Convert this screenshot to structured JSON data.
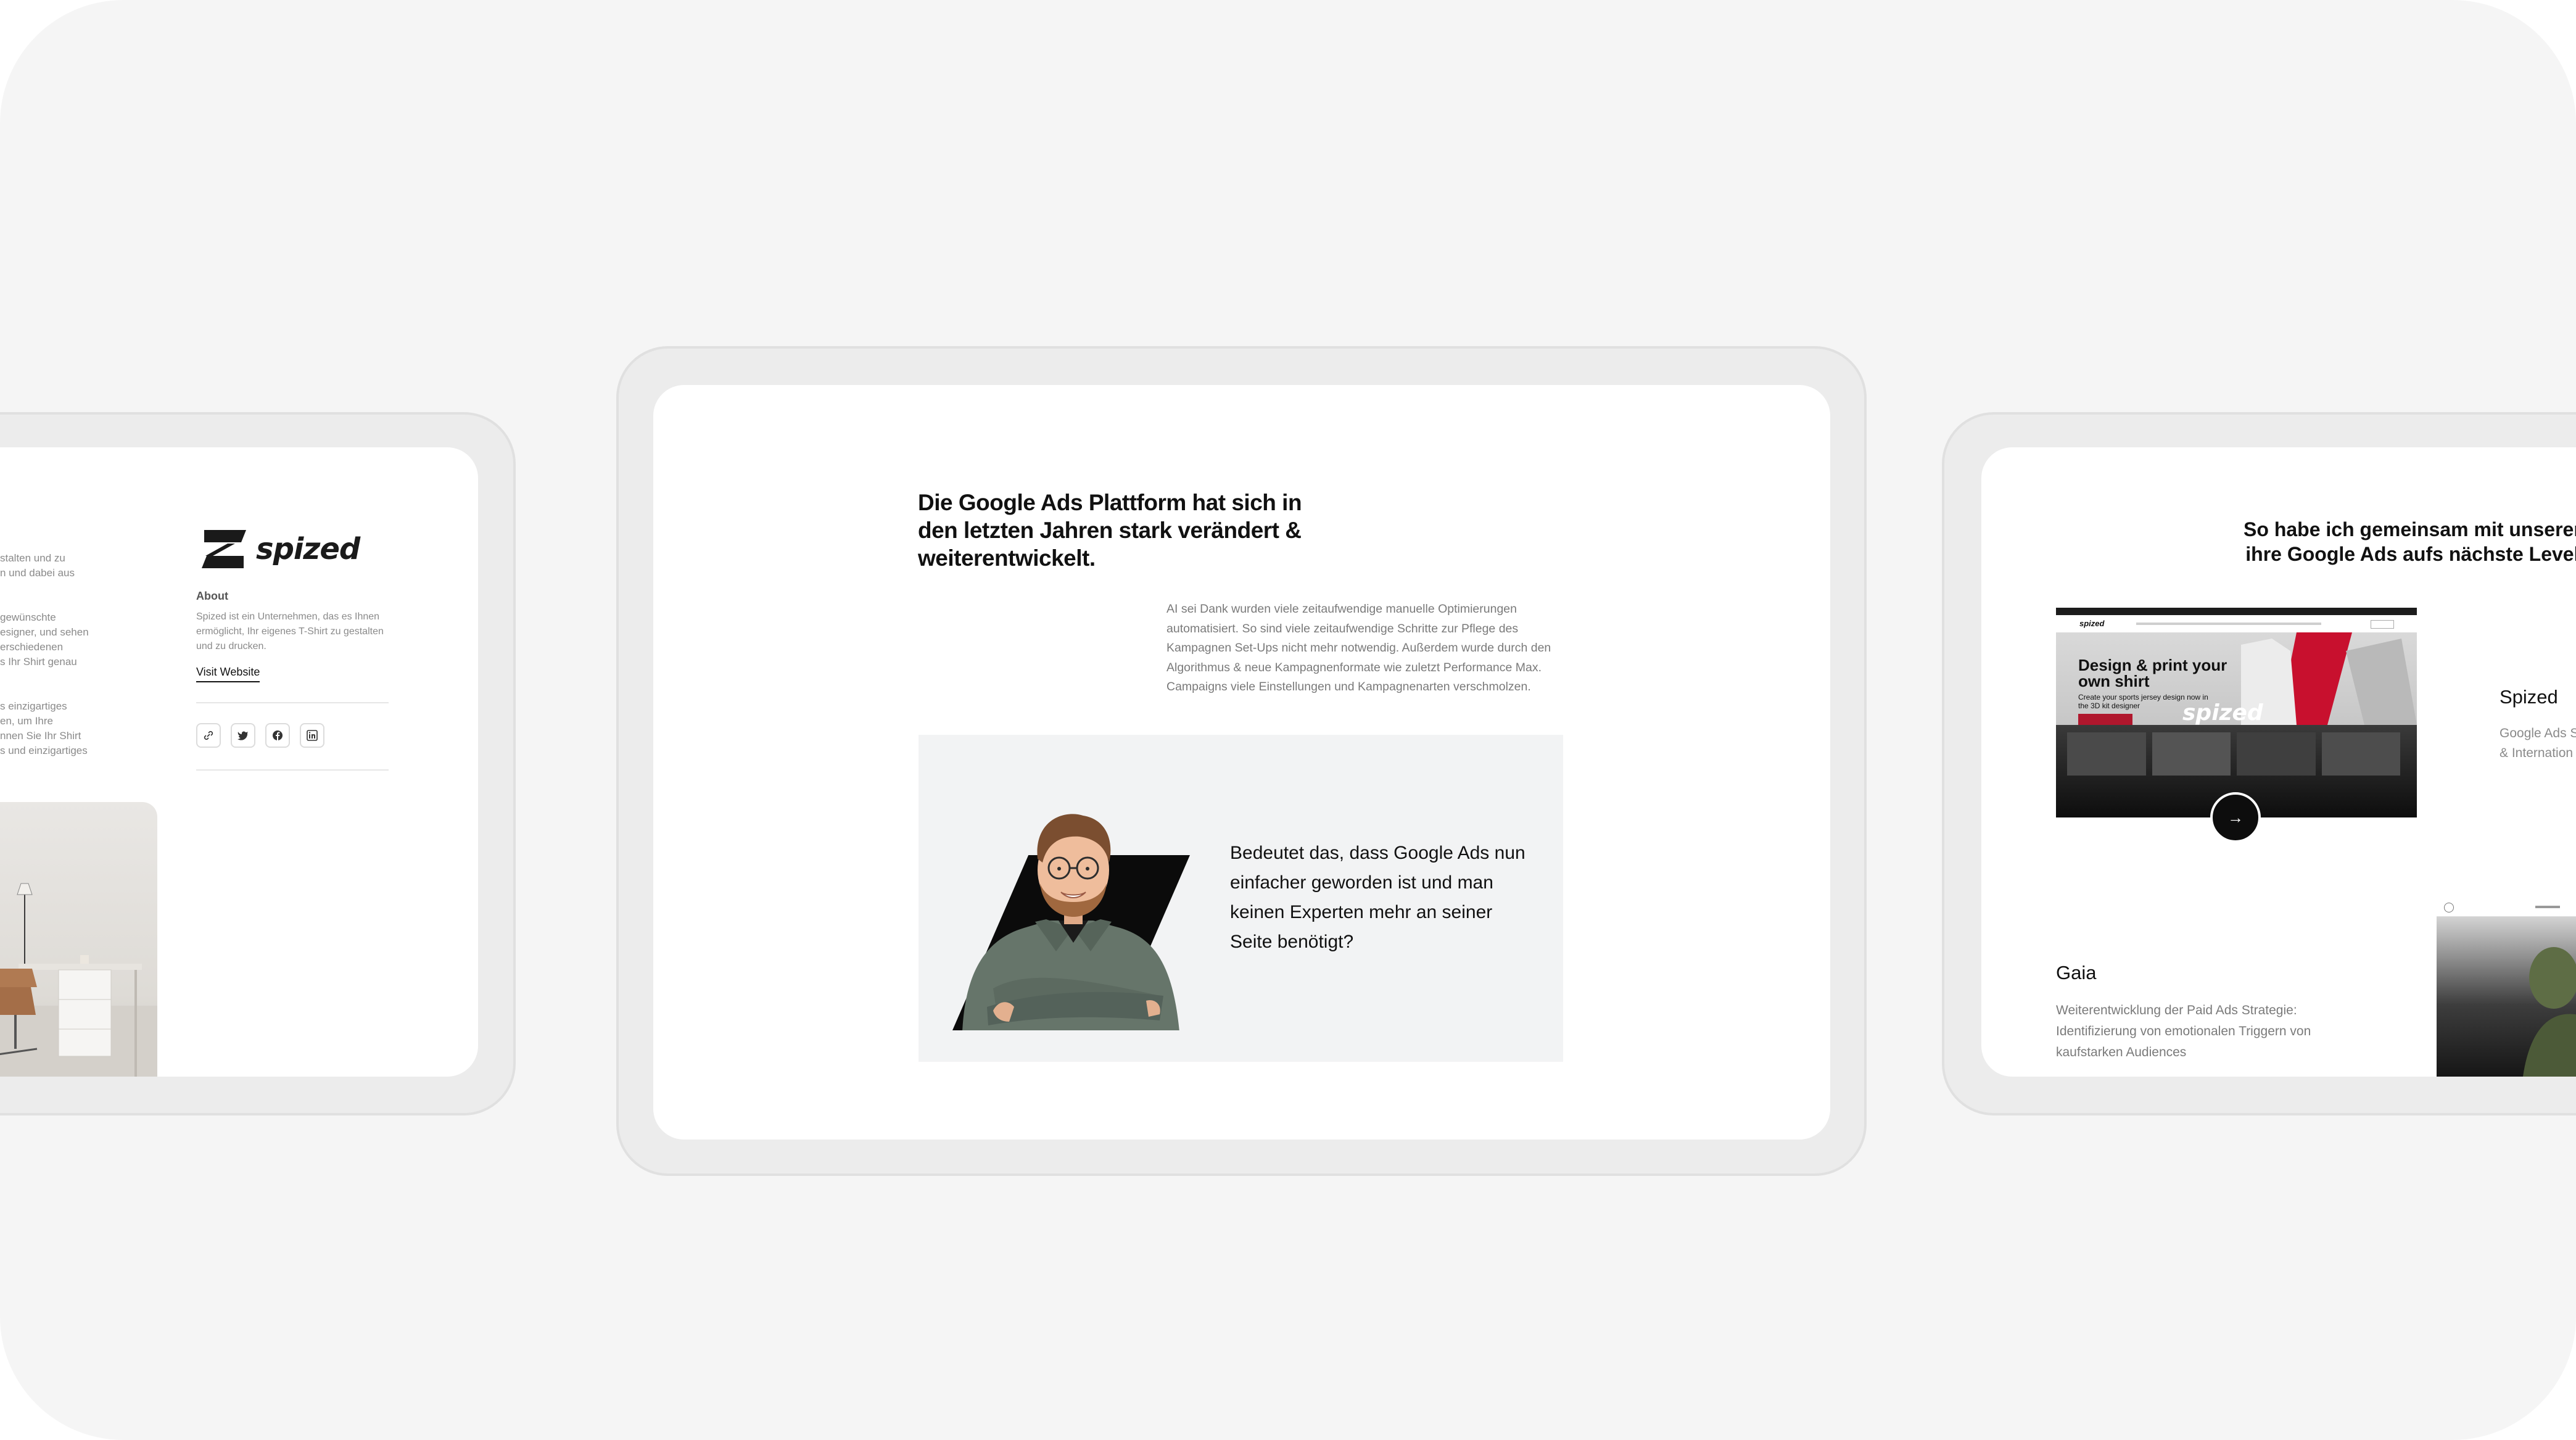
{
  "left_card": {
    "snippets": [
      "stalten und zu",
      "n und dabei aus",
      "gewünschte",
      "esigner, und sehen",
      "erschiedenen",
      "s Ihr Shirt genau",
      "s einzigartiges",
      "en, um Ihre",
      "nnen Sie Ihr Shirt",
      "s und einzigartiges"
    ],
    "logo_text": "spized",
    "about_title": "About",
    "about_text": "Spized ist ein Unternehmen, das es Ihnen ermöglicht, Ihr eigenes T-Shirt zu gestalten und zu drucken.",
    "visit_label": "Visit Website",
    "social_icons": [
      "link-icon",
      "twitter-icon",
      "facebook-icon",
      "linkedin-icon"
    ]
  },
  "center_card": {
    "headline": "Die Google Ads Plattform hat sich in den letzten Jahren stark verändert & weiterentwickelt.",
    "body": "AI sei Dank wurden viele zeitaufwendige manuelle Optimierungen automatisiert. So sind viele zeitaufwendige Schritte zur Pflege des Kampagnen Set-Ups nicht mehr notwendig. Außerdem wurde durch den Algorithmus & neue Kampagnenformate wie zuletzt Performance Max. Campaigns viele Einstellungen und Kampagnenarten verschmolzen.",
    "quote": "Bedeutet das, dass Google Ads nun einfacher geworden ist und man keinen Experten mehr an seiner Seite benötigt?"
  },
  "right_card": {
    "headline_line1": "So habe ich gemeinsam mit unseren Kun",
    "headline_line2": "ihre Google Ads aufs nächste Level gebr",
    "screenshot": {
      "nav_logo": "spized",
      "hero_title": "Design & print your own shirt",
      "hero_sub": "Create your sports jersey design now in the 3D kit designer",
      "hero_logo": "spized"
    },
    "spized_title": "Spized",
    "spized_desc_1": "Google Ads S",
    "spized_desc_2": "& Internation",
    "gaia_title": "Gaia",
    "gaia_desc": "Weiterentwicklung der Paid Ads Strategie: Identifizierung von emotionalen Triggern von kaufstarken Audiences",
    "arrow": "→"
  },
  "colors": {
    "background": "#f5f5f5",
    "frame": "#ececec",
    "panel_gray": "#f2f3f4",
    "text_dark": "#111111",
    "text_muted": "#7a7a7a",
    "accent_red": "#b0172d"
  }
}
